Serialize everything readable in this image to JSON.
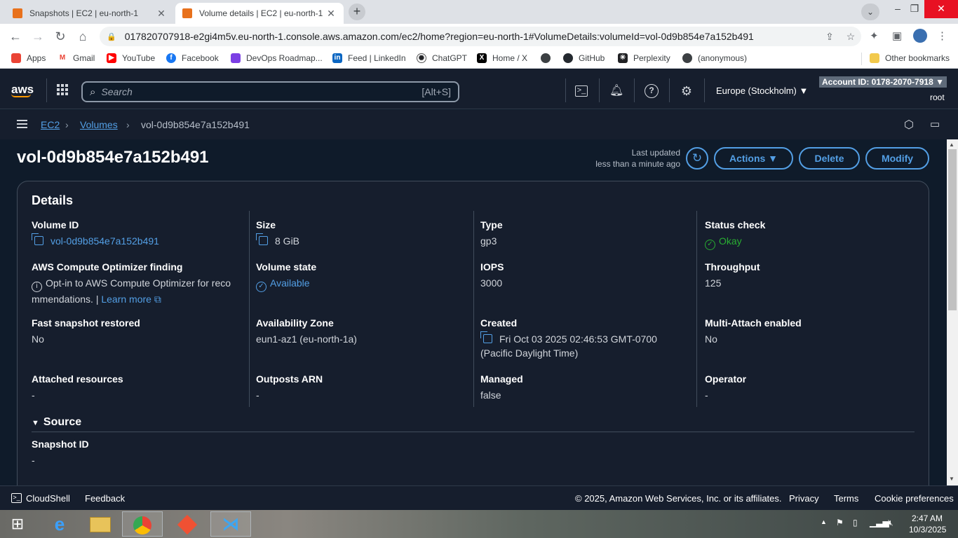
{
  "browser": {
    "tabs": [
      {
        "title": "Snapshots | EC2 | eu-north-1",
        "active": false
      },
      {
        "title": "Volume details | EC2 | eu-north-1",
        "active": true
      }
    ],
    "url": "017820707918-e2gi4m5v.eu-north-1.console.aws.amazon.com/ec2/home?region=eu-north-1#VolumeDetails:volumeId=vol-0d9b854e7a152b491",
    "bookmarks": [
      "Apps",
      "Gmail",
      "YouTube",
      "Facebook",
      "DevOps Roadmap...",
      "Feed | LinkedIn",
      "ChatGPT",
      "Home / X",
      "GitHub",
      "Perplexity",
      "(anonymous)"
    ],
    "other_bookmarks": "Other bookmarks"
  },
  "aws": {
    "logo": "aws",
    "search_placeholder": "Search",
    "search_shortcut": "[Alt+S]",
    "region": "Europe (Stockholm) ▼",
    "account": "Account ID: 0178-2070-7918 ▼",
    "user": "root"
  },
  "breadcrumb": {
    "ec2": "EC2",
    "volumes": "Volumes",
    "current": "vol-0d9b854e7a152b491"
  },
  "page": {
    "title": "vol-0d9b854e7a152b491",
    "last_updated_label": "Last updated",
    "last_updated_value": "less than a minute ago",
    "actions": "Actions ▼",
    "delete": "Delete",
    "modify": "Modify"
  },
  "details": {
    "heading": "Details",
    "volume_id_label": "Volume ID",
    "volume_id": "vol-0d9b854e7a152b491",
    "optimizer_label": "AWS Compute Optimizer finding",
    "optimizer_line1": "Opt-in to AWS Compute Optimizer for reco",
    "optimizer_line2": "mmendations. |",
    "learn_more": "Learn more",
    "fast_snapshot_label": "Fast snapshot restored",
    "fast_snapshot": "No",
    "attached_label": "Attached resources",
    "attached": "-",
    "size_label": "Size",
    "size": "8 GiB",
    "state_label": "Volume state",
    "state": "Available",
    "az_label": "Availability Zone",
    "az": "eun1-az1 (eu-north-1a)",
    "outposts_label": "Outposts ARN",
    "outposts": "-",
    "type_label": "Type",
    "type": "gp3",
    "iops_label": "IOPS",
    "iops": "3000",
    "created_label": "Created",
    "created_line1": "Fri Oct 03 2025 02:46:53 GMT-0700",
    "created_line2": "(Pacific Daylight Time)",
    "managed_label": "Managed",
    "managed": "false",
    "status_label": "Status check",
    "status": "Okay",
    "throughput_label": "Throughput",
    "throughput": "125",
    "multiattach_label": "Multi-Attach enabled",
    "multiattach": "No",
    "operator_label": "Operator",
    "operator": "-",
    "source_heading": "Source",
    "snapshot_id_label": "Snapshot ID",
    "snapshot_id": "-"
  },
  "footer": {
    "cloudshell": "CloudShell",
    "feedback": "Feedback",
    "copyright": "© 2025, Amazon Web Services, Inc. or its affiliates.",
    "privacy": "Privacy",
    "terms": "Terms",
    "cookies": "Cookie preferences"
  },
  "taskbar": {
    "time": "2:47 AM",
    "date": "10/3/2025"
  },
  "colors": {
    "link": "#539fe5",
    "ok": "#29ad32",
    "header": "#161e2d",
    "bg": "#0f1b2a"
  }
}
